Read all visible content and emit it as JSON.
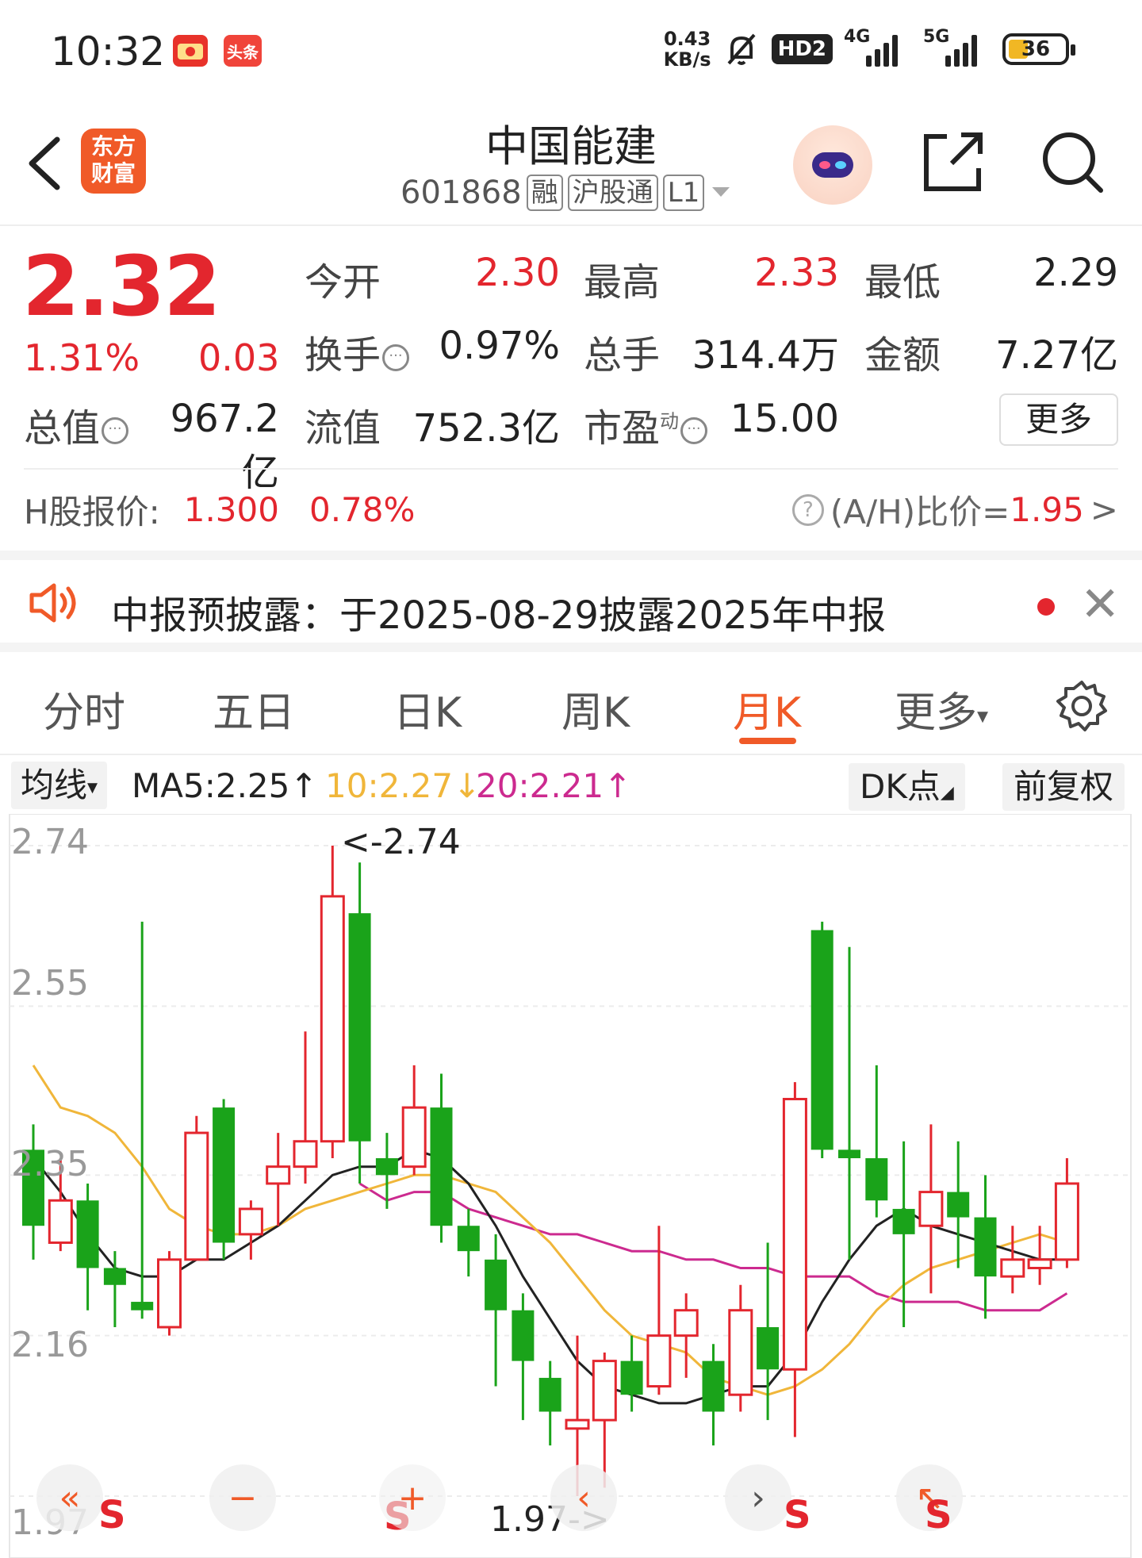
{
  "status_bar": {
    "time": "10:32",
    "app1": "",
    "app2": "头条",
    "speed_value": "0.43",
    "speed_unit": "KB/s",
    "hd": "HD2",
    "sig1": "4G",
    "sig2": "5G",
    "battery": "36",
    "battery_level": 0.36
  },
  "header": {
    "app_logo_line1": "东方",
    "app_logo_line2": "财富",
    "stock_name": "中国能建",
    "stock_code": "601868",
    "tags": [
      "融",
      "沪股通",
      "L1"
    ]
  },
  "quote": {
    "price": "2.32",
    "pct_change": "1.31%",
    "amt_change": "0.03",
    "open_label": "今开",
    "open": "2.30",
    "high_label": "最高",
    "high": "2.33",
    "low_label": "最低",
    "low": "2.29",
    "turnover_label": "换手",
    "turnover": "0.97%",
    "volume_label": "总手",
    "volume": "314.4万",
    "amount_label": "金额",
    "amount": "7.27亿",
    "mktcap_label": "总值",
    "mktcap": "967.2亿",
    "float_label": "流值",
    "float": "752.3亿",
    "pe_label": "市盈",
    "pe_sup": "动",
    "pe": "15.00",
    "more": "更多"
  },
  "h_share": {
    "label": "H股报价:",
    "price": "1.300",
    "pct": "0.78%",
    "ah_label": "(A/H)比价=",
    "ah_value": "1.95",
    "arrow": ">"
  },
  "notice": {
    "text": "中报预披露：于2025-08-29披露2025年中报",
    "close": "✕"
  },
  "tabs": [
    "分时",
    "五日",
    "日K",
    "周K",
    "月K",
    "更多"
  ],
  "active_tab": 4,
  "ma": {
    "select": "均线",
    "ma5": "MA5:2.25",
    "ma5_arrow": "↑",
    "ma10": "10:2.27",
    "ma10_arrow": "↓",
    "ma20": "20:2.21",
    "ma20_arrow": "↑",
    "dk": "DK点",
    "adj": "前复权",
    "colors": {
      "ma5": "#222222",
      "ma10": "#f0b63a",
      "ma20": "#cc2a8f"
    }
  },
  "chart_data": {
    "type": "candlestick",
    "y_ticks": [
      "2.74",
      "2.55",
      "2.35",
      "2.16",
      "1.97"
    ],
    "ylim": [
      1.97,
      2.74
    ],
    "max_annotation": "<-2.74",
    "min_annotation": "1.97->",
    "colors": {
      "up": "#e3262e",
      "down": "#1aa31a"
    },
    "candles": [
      {
        "o": 2.38,
        "c": 2.29,
        "h": 2.41,
        "l": 2.25
      },
      {
        "o": 2.27,
        "c": 2.32,
        "h": 2.37,
        "l": 2.26
      },
      {
        "o": 2.32,
        "c": 2.24,
        "h": 2.34,
        "l": 2.19
      },
      {
        "o": 2.24,
        "c": 2.22,
        "h": 2.26,
        "l": 2.17
      },
      {
        "o": 2.2,
        "c": 2.19,
        "h": 2.65,
        "l": 2.18
      },
      {
        "o": 2.17,
        "c": 2.25,
        "h": 2.26,
        "l": 2.16
      },
      {
        "o": 2.25,
        "c": 2.4,
        "h": 2.42,
        "l": 2.25
      },
      {
        "o": 2.43,
        "c": 2.27,
        "h": 2.44,
        "l": 2.25
      },
      {
        "o": 2.28,
        "c": 2.31,
        "h": 2.32,
        "l": 2.25
      },
      {
        "o": 2.34,
        "c": 2.36,
        "h": 2.4,
        "l": 2.29
      },
      {
        "o": 2.36,
        "c": 2.39,
        "h": 2.52,
        "l": 2.34
      },
      {
        "o": 2.39,
        "c": 2.68,
        "h": 2.74,
        "l": 2.37
      },
      {
        "o": 2.66,
        "c": 2.39,
        "h": 2.72,
        "l": 2.34
      },
      {
        "o": 2.37,
        "c": 2.35,
        "h": 2.4,
        "l": 2.31
      },
      {
        "o": 2.36,
        "c": 2.43,
        "h": 2.48,
        "l": 2.35
      },
      {
        "o": 2.43,
        "c": 2.29,
        "h": 2.47,
        "l": 2.27
      },
      {
        "o": 2.29,
        "c": 2.26,
        "h": 2.31,
        "l": 2.23
      },
      {
        "o": 2.25,
        "c": 2.19,
        "h": 2.28,
        "l": 2.1
      },
      {
        "o": 2.19,
        "c": 2.13,
        "h": 2.21,
        "l": 2.06
      },
      {
        "o": 2.11,
        "c": 2.07,
        "h": 2.13,
        "l": 2.03
      },
      {
        "o": 2.05,
        "c": 2.06,
        "h": 2.16,
        "l": 1.97
      },
      {
        "o": 2.06,
        "c": 2.13,
        "h": 2.14,
        "l": 1.98
      },
      {
        "o": 2.13,
        "c": 2.09,
        "h": 2.16,
        "l": 2.07
      },
      {
        "o": 2.1,
        "c": 2.16,
        "h": 2.29,
        "l": 2.09
      },
      {
        "o": 2.16,
        "c": 2.19,
        "h": 2.21,
        "l": 2.11
      },
      {
        "o": 2.13,
        "c": 2.07,
        "h": 2.15,
        "l": 2.03
      },
      {
        "o": 2.09,
        "c": 2.19,
        "h": 2.22,
        "l": 2.07
      },
      {
        "o": 2.17,
        "c": 2.12,
        "h": 2.27,
        "l": 2.06
      },
      {
        "o": 2.12,
        "c": 2.44,
        "h": 2.46,
        "l": 2.04
      },
      {
        "o": 2.64,
        "c": 2.38,
        "h": 2.65,
        "l": 2.37
      },
      {
        "o": 2.38,
        "c": 2.37,
        "h": 2.62,
        "l": 2.25
      },
      {
        "o": 2.37,
        "c": 2.32,
        "h": 2.48,
        "l": 2.3
      },
      {
        "o": 2.31,
        "c": 2.28,
        "h": 2.39,
        "l": 2.17
      },
      {
        "o": 2.29,
        "c": 2.33,
        "h": 2.41,
        "l": 2.21
      },
      {
        "o": 2.33,
        "c": 2.3,
        "h": 2.39,
        "l": 2.24
      },
      {
        "o": 2.3,
        "c": 2.23,
        "h": 2.35,
        "l": 2.18
      },
      {
        "o": 2.23,
        "c": 2.25,
        "h": 2.29,
        "l": 2.21
      },
      {
        "o": 2.24,
        "c": 2.25,
        "h": 2.29,
        "l": 2.22
      },
      {
        "o": 2.25,
        "c": 2.34,
        "h": 2.37,
        "l": 2.24
      }
    ],
    "ma5": [
      2.37,
      2.33,
      2.28,
      2.24,
      2.23,
      2.23,
      2.25,
      2.25,
      2.27,
      2.29,
      2.32,
      2.35,
      2.36,
      2.36,
      2.38,
      2.37,
      2.34,
      2.29,
      2.23,
      2.18,
      2.13,
      2.1,
      2.09,
      2.08,
      2.08,
      2.09,
      2.1,
      2.1,
      2.14,
      2.2,
      2.25,
      2.29,
      2.31,
      2.29,
      2.28,
      2.27,
      2.26,
      2.25,
      2.25
    ],
    "ma10": [
      2.48,
      2.43,
      2.42,
      2.4,
      2.36,
      2.31,
      2.29,
      2.28,
      2.28,
      2.29,
      2.31,
      2.32,
      2.33,
      2.34,
      2.35,
      2.35,
      2.34,
      2.33,
      2.3,
      2.27,
      2.23,
      2.19,
      2.16,
      2.15,
      2.14,
      2.11,
      2.1,
      2.09,
      2.1,
      2.12,
      2.15,
      2.19,
      2.22,
      2.24,
      2.25,
      2.26,
      2.27,
      2.28,
      2.27
    ],
    "ma20": [
      null,
      null,
      null,
      null,
      null,
      null,
      null,
      null,
      null,
      null,
      null,
      null,
      2.34,
      2.32,
      2.33,
      2.33,
      2.31,
      2.3,
      2.29,
      2.28,
      2.28,
      2.27,
      2.26,
      2.26,
      2.25,
      2.25,
      2.24,
      2.24,
      2.23,
      2.23,
      2.23,
      2.21,
      2.2,
      2.2,
      2.2,
      2.19,
      2.19,
      2.19,
      2.21
    ]
  },
  "chart_controls": {
    "first": "«",
    "zoom_out": "−",
    "zoom_in": "+",
    "prev": "‹",
    "next": "›",
    "last": "↖",
    "s_mark": "S"
  }
}
